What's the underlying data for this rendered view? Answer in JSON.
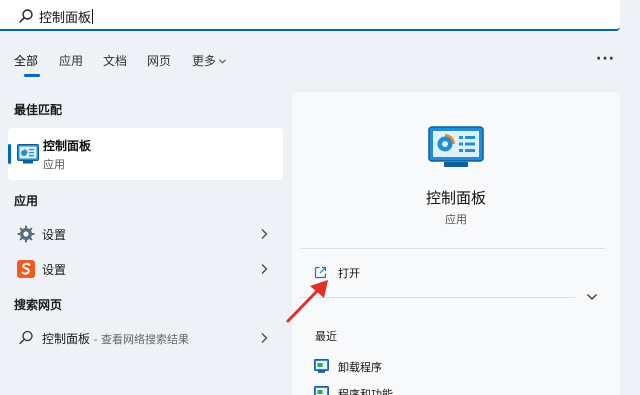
{
  "search": {
    "value": "控制面板"
  },
  "tabs": [
    {
      "label": "全部",
      "active": true
    },
    {
      "label": "应用"
    },
    {
      "label": "文档"
    },
    {
      "label": "网页"
    },
    {
      "label": "更多"
    }
  ],
  "more_options": "···",
  "best_match": {
    "heading": "最佳匹配",
    "title": "控制面板",
    "subtitle": "应用"
  },
  "apps": {
    "heading": "应用",
    "items": [
      {
        "label": "设置",
        "icon": "gear-icon"
      },
      {
        "label": "设置",
        "icon": "sogou-s-icon"
      }
    ]
  },
  "web": {
    "heading": "搜索网页",
    "item": {
      "label": "控制面板",
      "suffix": " - 查看网络搜索结果"
    }
  },
  "detail": {
    "title": "控制面板",
    "subtitle": "应用",
    "open_label": "打开",
    "recent_heading": "最近",
    "recent": [
      {
        "label": "卸载程序"
      },
      {
        "label": "程序和功能"
      }
    ]
  },
  "colors": {
    "accent": "#0067c0",
    "annotation_arrow": "#e0302a",
    "background": "#eef1f6"
  }
}
